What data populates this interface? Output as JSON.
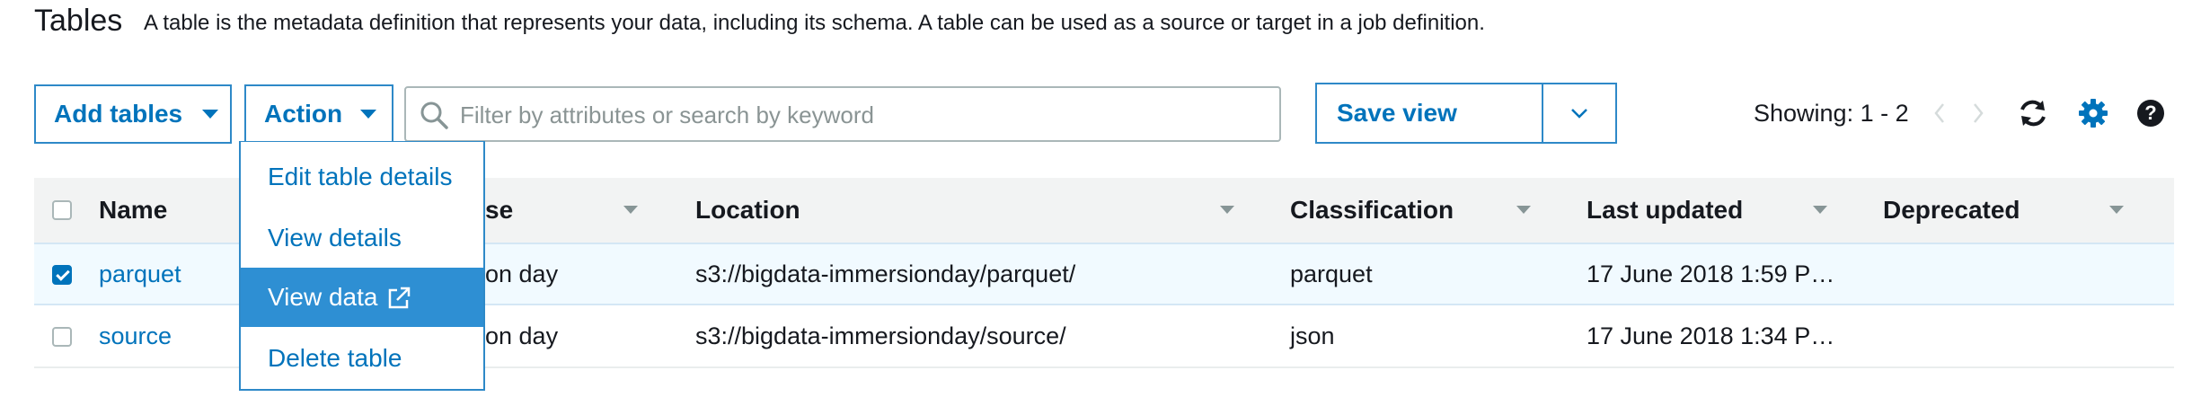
{
  "header": {
    "title": "Tables",
    "description": "A table is the metadata definition that represents your data, including its schema. A table can be used as a source or target in a job definition."
  },
  "toolbar": {
    "add_tables_label": "Add tables",
    "action_label": "Action",
    "search_placeholder": "Filter by attributes or search by keyword",
    "save_view_label": "Save view",
    "showing_text": "Showing: 1 - 2"
  },
  "action_menu": {
    "items": [
      {
        "label": "Edit table details"
      },
      {
        "label": "View details"
      },
      {
        "label": "View data"
      },
      {
        "label": "Delete table"
      }
    ]
  },
  "table": {
    "columns": [
      "Name",
      "se",
      "Location",
      "Classification",
      "Last updated",
      "Deprecated"
    ],
    "rows": [
      {
        "name": "parquet",
        "database": "on day",
        "location": "s3://bigdata-immersionday/parquet/",
        "classification": "parquet",
        "last_updated": "17 June 2018 1:59 P…",
        "deprecated": "",
        "selected": true
      },
      {
        "name": "source",
        "database": "on day",
        "location": "s3://bigdata-immersionday/source/",
        "classification": "json",
        "last_updated": "17 June 2018 1:34 P…",
        "deprecated": "",
        "selected": false
      }
    ]
  },
  "colors": {
    "accent": "#0073bb",
    "selected_row": "#f1faff",
    "menu_active": "#2e8fd3",
    "header_bg": "#f2f3f3"
  },
  "icons": [
    "search-icon",
    "caret-down-icon",
    "chevron-left-icon",
    "chevron-right-icon",
    "refresh-icon",
    "gear-icon",
    "help-icon",
    "external-link-icon"
  ]
}
